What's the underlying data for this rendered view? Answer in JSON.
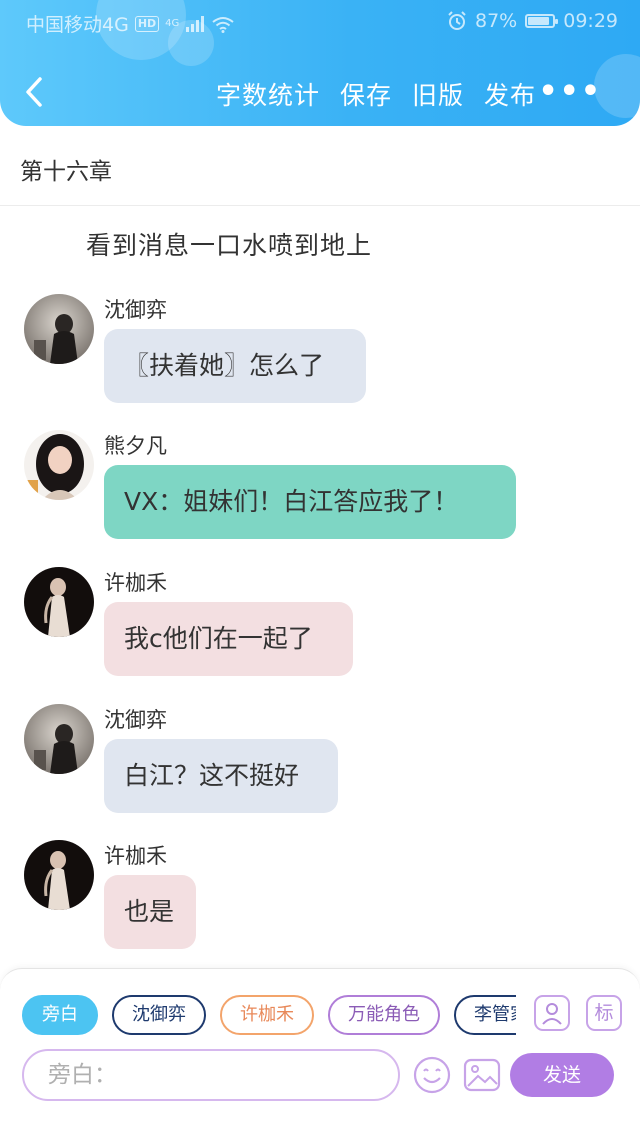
{
  "status_bar": {
    "carrier": "中国移动4G",
    "hd": "HD",
    "net": "4G",
    "battery": "87%",
    "battery_level": 0.87,
    "time": "09:29"
  },
  "navbar": {
    "actions": [
      "字数统计",
      "保存",
      "旧版",
      "发布"
    ],
    "more": "•••"
  },
  "chapter": {
    "title": "第十六章"
  },
  "narration": "看到消息一口水喷到地上",
  "messages": [
    {
      "sender": "沈御弈",
      "text": "〖扶着她〗怎么了",
      "style": "blue"
    },
    {
      "sender": "熊夕凡",
      "text": "VX：姐妹们！白江答应我了！",
      "style": "teal"
    },
    {
      "sender": "许枷禾",
      "text": "我c他们在一起了",
      "style": "pink"
    },
    {
      "sender": "沈御弈",
      "text": "白江？这不挺好",
      "style": "blue"
    },
    {
      "sender": "许枷禾",
      "text": "也是",
      "style": "pink"
    }
  ],
  "bottom": {
    "chips": [
      "旁白",
      "沈御弈",
      "许枷禾",
      "万能角色",
      "李管家"
    ],
    "tag_icon_label": "标",
    "input_placeholder": "旁白：",
    "send_label": "发送"
  },
  "colors": {
    "header_gradient": [
      "#5ec9fb",
      "#2ea9f4"
    ],
    "bubble_blue": "#e0e6f0",
    "bubble_teal": "#7ed6c4",
    "bubble_pink": "#f3dfe1",
    "chip_active": "#4cc4f2",
    "send_button": "#b17de4"
  }
}
